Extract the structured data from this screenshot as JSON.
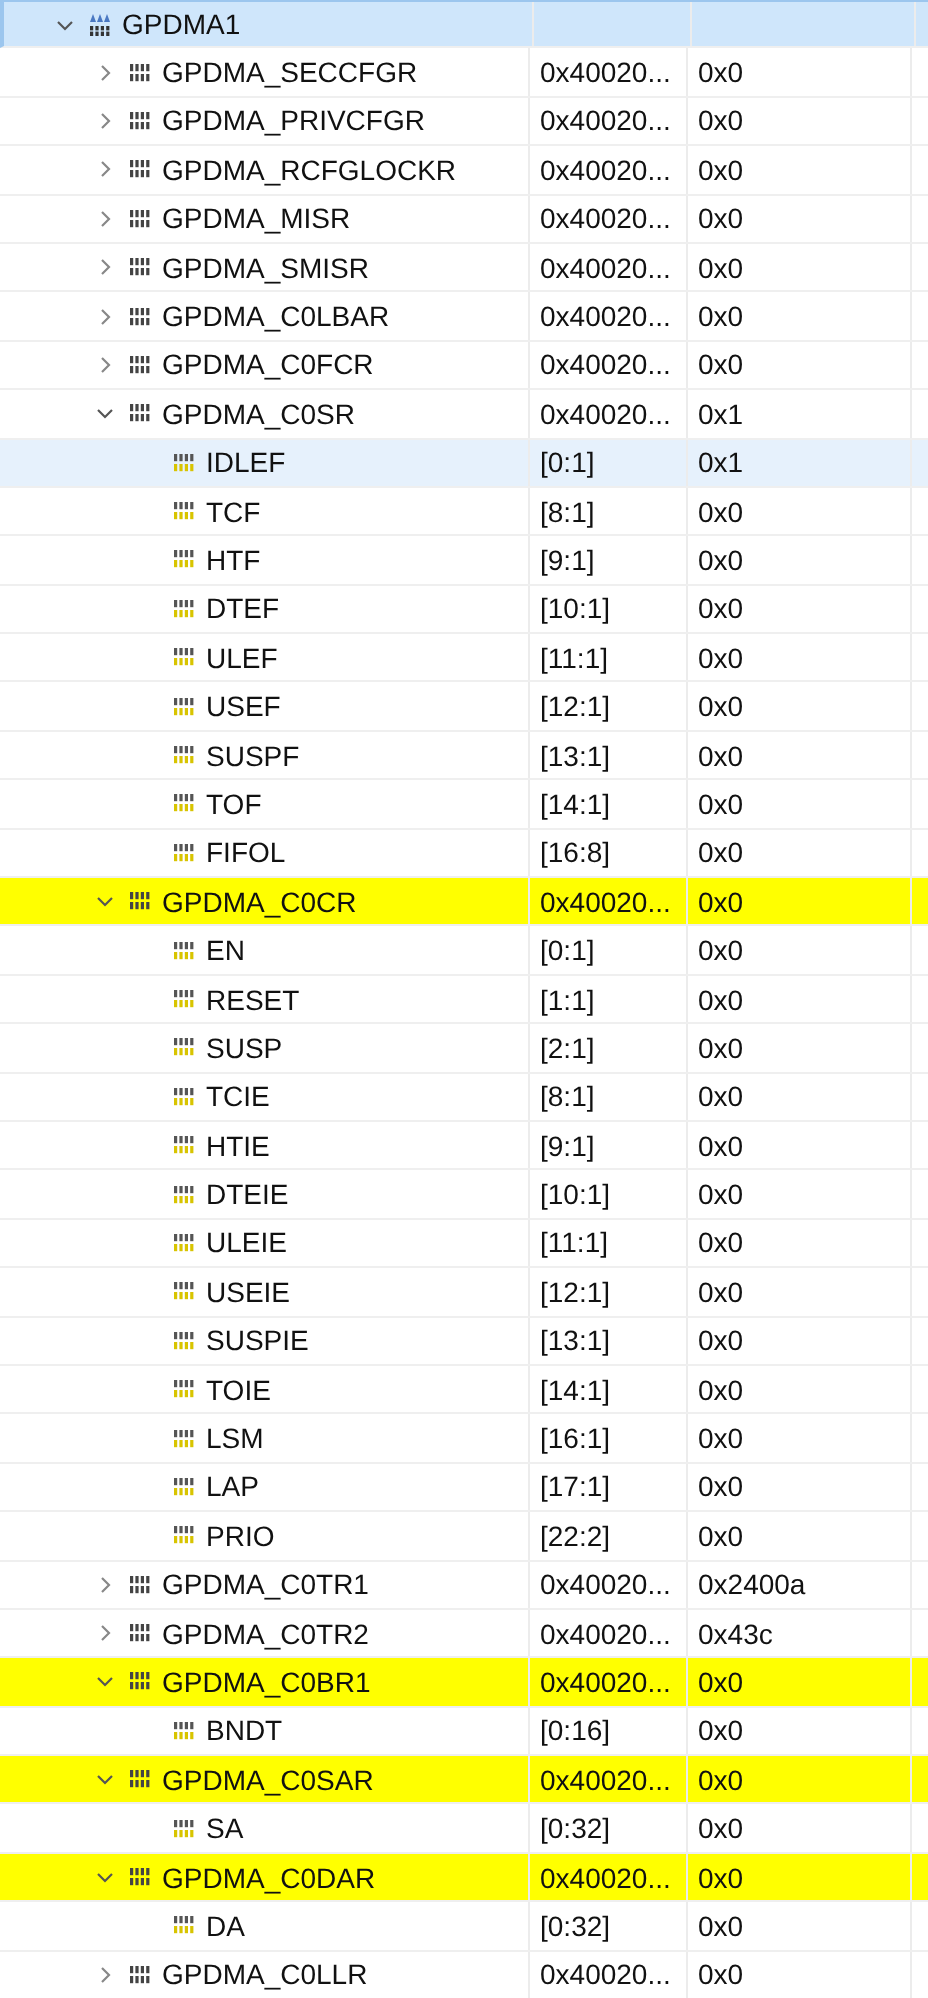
{
  "tree": [
    {
      "name": "GPDMA1",
      "kind": "peripheral",
      "expanded": true,
      "selected": true,
      "highlighted": false,
      "children": [
        {
          "name": "GPDMA_SECCFGR",
          "kind": "register",
          "expanded": false,
          "selected": false,
          "highlighted": false,
          "column_2": "0x40020...",
          "column_3": "0x0"
        },
        {
          "name": "GPDMA_PRIVCFGR",
          "kind": "register",
          "expanded": false,
          "selected": false,
          "highlighted": false,
          "column_2": "0x40020...",
          "column_3": "0x0"
        },
        {
          "name": "GPDMA_RCFGLOCKR",
          "kind": "register",
          "expanded": false,
          "selected": false,
          "highlighted": false,
          "column_2": "0x40020...",
          "column_3": "0x0"
        },
        {
          "name": "GPDMA_MISR",
          "kind": "register",
          "expanded": false,
          "selected": false,
          "highlighted": false,
          "column_2": "0x40020...",
          "column_3": "0x0"
        },
        {
          "name": "GPDMA_SMISR",
          "kind": "register",
          "expanded": false,
          "selected": false,
          "highlighted": false,
          "column_2": "0x40020...",
          "column_3": "0x0"
        },
        {
          "name": "GPDMA_C0LBAR",
          "kind": "register",
          "expanded": false,
          "selected": false,
          "highlighted": false,
          "column_2": "0x40020...",
          "column_3": "0x0"
        },
        {
          "name": "GPDMA_C0FCR",
          "kind": "register",
          "expanded": false,
          "selected": false,
          "highlighted": false,
          "column_2": "0x40020...",
          "column_3": "0x0"
        },
        {
          "name": "GPDMA_C0SR",
          "kind": "register",
          "expanded": true,
          "selected": false,
          "highlighted": false,
          "column_2": "0x40020...",
          "column_3": "0x1",
          "children": [
            {
              "name": "IDLEF",
              "kind": "field",
              "selected": true,
              "highlighted": false,
              "column_2": "[0:1]",
              "column_3": "0x1"
            },
            {
              "name": "TCF",
              "kind": "field",
              "selected": false,
              "highlighted": false,
              "column_2": "[8:1]",
              "column_3": "0x0"
            },
            {
              "name": "HTF",
              "kind": "field",
              "selected": false,
              "highlighted": false,
              "column_2": "[9:1]",
              "column_3": "0x0"
            },
            {
              "name": "DTEF",
              "kind": "field",
              "selected": false,
              "highlighted": false,
              "column_2": "[10:1]",
              "column_3": "0x0"
            },
            {
              "name": "ULEF",
              "kind": "field",
              "selected": false,
              "highlighted": false,
              "column_2": "[11:1]",
              "column_3": "0x0"
            },
            {
              "name": "USEF",
              "kind": "field",
              "selected": false,
              "highlighted": false,
              "column_2": "[12:1]",
              "column_3": "0x0"
            },
            {
              "name": "SUSPF",
              "kind": "field",
              "selected": false,
              "highlighted": false,
              "column_2": "[13:1]",
              "column_3": "0x0"
            },
            {
              "name": "TOF",
              "kind": "field",
              "selected": false,
              "highlighted": false,
              "column_2": "[14:1]",
              "column_3": "0x0"
            },
            {
              "name": "FIFOL",
              "kind": "field",
              "selected": false,
              "highlighted": false,
              "column_2": "[16:8]",
              "column_3": "0x0"
            }
          ]
        },
        {
          "name": "GPDMA_C0CR",
          "kind": "register",
          "expanded": true,
          "selected": false,
          "highlighted": true,
          "column_2": "0x40020...",
          "column_3": "0x0",
          "children": [
            {
              "name": "EN",
              "kind": "field",
              "selected": false,
              "highlighted": false,
              "column_2": "[0:1]",
              "column_3": "0x0"
            },
            {
              "name": "RESET",
              "kind": "field",
              "selected": false,
              "highlighted": false,
              "column_2": "[1:1]",
              "column_3": "0x0"
            },
            {
              "name": "SUSP",
              "kind": "field",
              "selected": false,
              "highlighted": false,
              "column_2": "[2:1]",
              "column_3": "0x0"
            },
            {
              "name": "TCIE",
              "kind": "field",
              "selected": false,
              "highlighted": false,
              "column_2": "[8:1]",
              "column_3": "0x0"
            },
            {
              "name": "HTIE",
              "kind": "field",
              "selected": false,
              "highlighted": false,
              "column_2": "[9:1]",
              "column_3": "0x0"
            },
            {
              "name": "DTEIE",
              "kind": "field",
              "selected": false,
              "highlighted": false,
              "column_2": "[10:1]",
              "column_3": "0x0"
            },
            {
              "name": "ULEIE",
              "kind": "field",
              "selected": false,
              "highlighted": false,
              "column_2": "[11:1]",
              "column_3": "0x0"
            },
            {
              "name": "USEIE",
              "kind": "field",
              "selected": false,
              "highlighted": false,
              "column_2": "[12:1]",
              "column_3": "0x0"
            },
            {
              "name": "SUSPIE",
              "kind": "field",
              "selected": false,
              "highlighted": false,
              "column_2": "[13:1]",
              "column_3": "0x0"
            },
            {
              "name": "TOIE",
              "kind": "field",
              "selected": false,
              "highlighted": false,
              "column_2": "[14:1]",
              "column_3": "0x0"
            },
            {
              "name": "LSM",
              "kind": "field",
              "selected": false,
              "highlighted": false,
              "column_2": "[16:1]",
              "column_3": "0x0"
            },
            {
              "name": "LAP",
              "kind": "field",
              "selected": false,
              "highlighted": false,
              "column_2": "[17:1]",
              "column_3": "0x0"
            },
            {
              "name": "PRIO",
              "kind": "field",
              "selected": false,
              "highlighted": false,
              "column_2": "[22:2]",
              "column_3": "0x0"
            }
          ]
        },
        {
          "name": "GPDMA_C0TR1",
          "kind": "register",
          "expanded": false,
          "selected": false,
          "highlighted": false,
          "column_2": "0x40020...",
          "column_3": "0x2400a"
        },
        {
          "name": "GPDMA_C0TR2",
          "kind": "register",
          "expanded": false,
          "selected": false,
          "highlighted": false,
          "column_2": "0x40020...",
          "column_3": "0x43c"
        },
        {
          "name": "GPDMA_C0BR1",
          "kind": "register",
          "expanded": true,
          "selected": false,
          "highlighted": true,
          "column_2": "0x40020...",
          "column_3": "0x0",
          "children": [
            {
              "name": "BNDT",
              "kind": "field",
              "selected": false,
              "highlighted": false,
              "column_2": "[0:16]",
              "column_3": "0x0"
            }
          ]
        },
        {
          "name": "GPDMA_C0SAR",
          "kind": "register",
          "expanded": true,
          "selected": false,
          "highlighted": true,
          "column_2": "0x40020...",
          "column_3": "0x0",
          "children": [
            {
              "name": "SA",
              "kind": "field",
              "selected": false,
              "highlighted": false,
              "column_2": "[0:32]",
              "column_3": "0x0"
            }
          ]
        },
        {
          "name": "GPDMA_C0DAR",
          "kind": "register",
          "expanded": true,
          "selected": false,
          "highlighted": true,
          "column_2": "0x40020...",
          "column_3": "0x0",
          "children": [
            {
              "name": "DA",
              "kind": "field",
              "selected": false,
              "highlighted": false,
              "column_2": "[0:32]",
              "column_3": "0x0"
            }
          ]
        },
        {
          "name": "GPDMA_C0LLR",
          "kind": "register",
          "expanded": false,
          "selected": false,
          "highlighted": false,
          "column_2": "0x40020...",
          "column_3": "0x0"
        }
      ]
    }
  ]
}
